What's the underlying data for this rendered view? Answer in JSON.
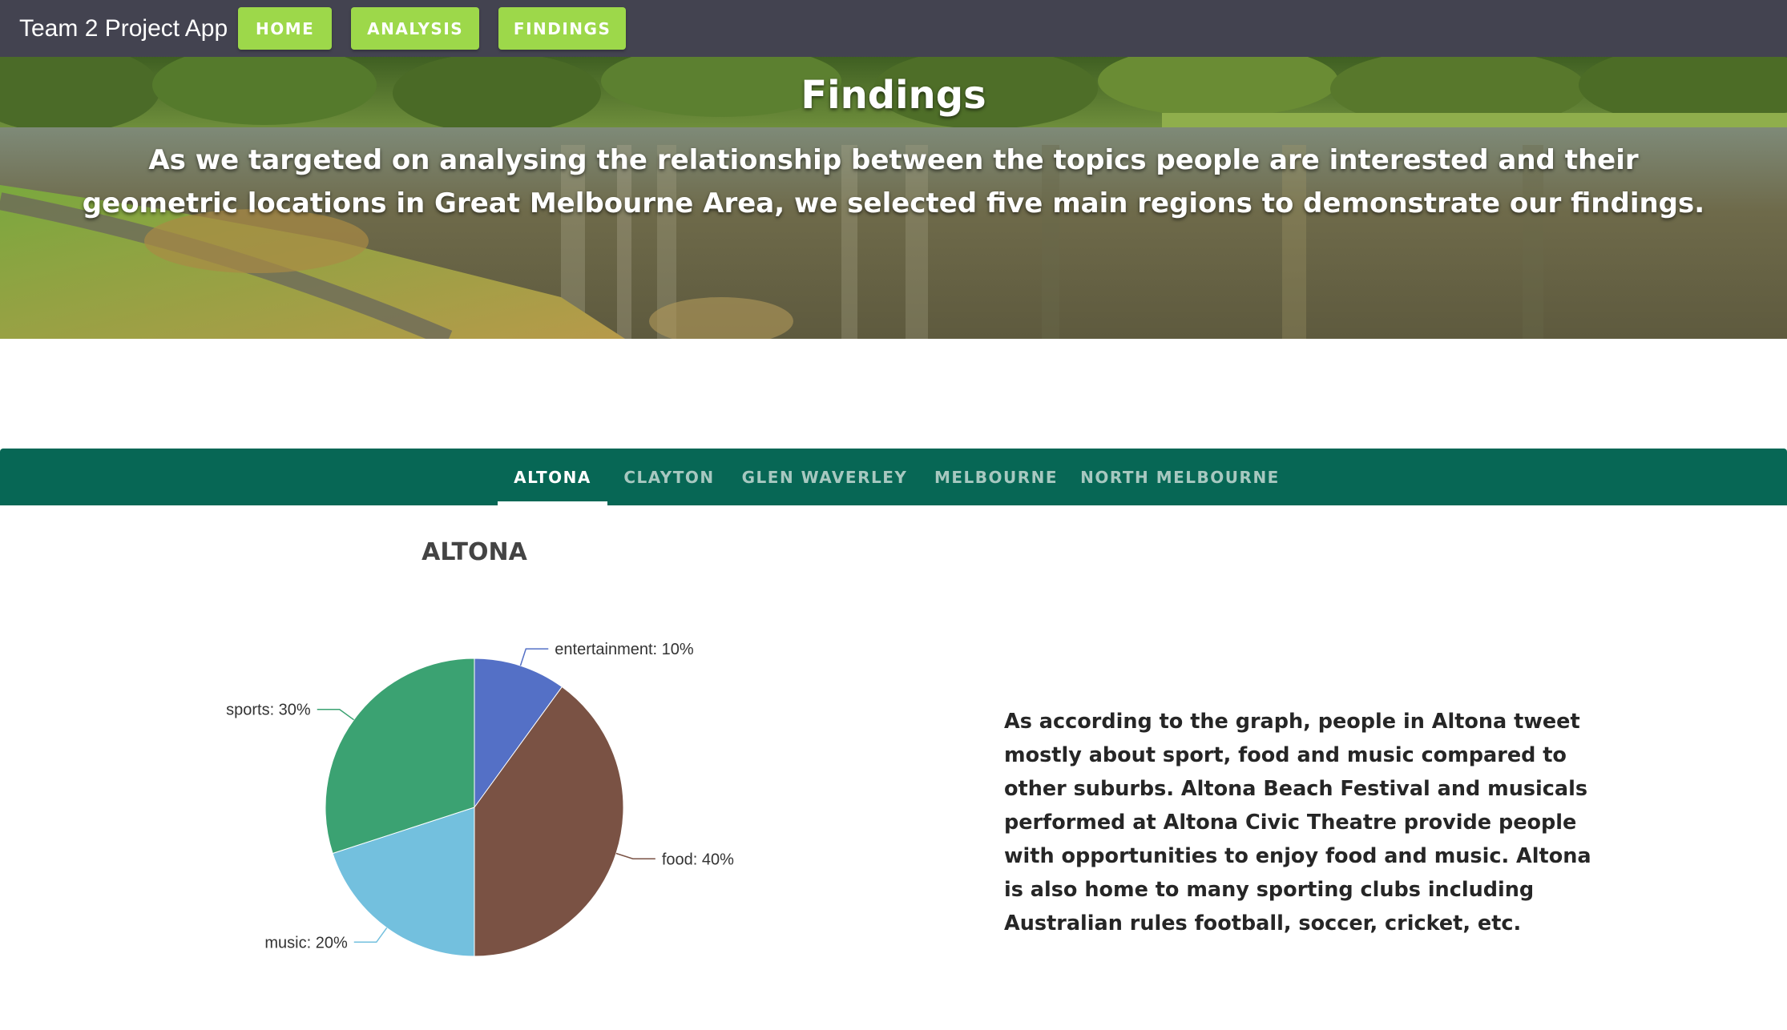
{
  "navbar": {
    "brand": "Team 2 Project App",
    "buttons": [
      "HOME",
      "ANALYSIS",
      "FINDINGS"
    ]
  },
  "hero": {
    "title": "Findings",
    "text": "As we targeted on analysing the relationship between the topics people are interested and their geometric locations in Great Melbourne Area, we selected five main regions to demonstrate our findings."
  },
  "tabs": {
    "items": [
      "ALTONA",
      "CLAYTON",
      "GLEN WAVERLEY",
      "MELBOURNE",
      "NORTH MELBOURNE"
    ],
    "active": "ALTONA"
  },
  "chart_data": {
    "type": "pie",
    "title": "ALTONA",
    "slices": [
      {
        "name": "entertainment",
        "value": 10,
        "label": "entertainment: 10%",
        "color": "#5470c6"
      },
      {
        "name": "food",
        "value": 40,
        "label": "food: 40%",
        "color": "#7a5244"
      },
      {
        "name": "music",
        "value": 20,
        "label": "music: 20%",
        "color": "#73c0de"
      },
      {
        "name": "sports",
        "value": 30,
        "label": "sports: 30%",
        "color": "#3ba272"
      }
    ]
  },
  "description": "As according to the graph, people in Altona tweet mostly about sport, food and music compared to other suburbs. Altona Beach Festival and musicals performed at Altona Civic Theatre provide people with opportunities to enjoy food and music. Altona is also home to many sporting clubs including Australian rules football, soccer, cricket, etc.",
  "colors": {
    "navbar": "#434350",
    "button": "#9dd84a",
    "tabs_bar": "#076755",
    "tab_inactive": "#a7c8c0"
  }
}
